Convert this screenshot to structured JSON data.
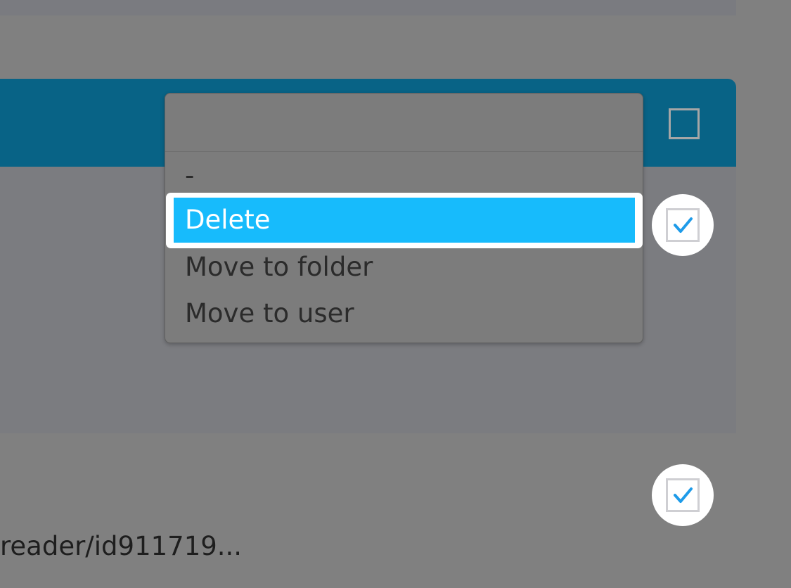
{
  "dropdown": {
    "options": [
      "-",
      "Delete",
      "Move to folder",
      "Move to user"
    ],
    "selected": "Delete"
  },
  "rows": [
    {
      "checked": true
    },
    {
      "checked": true,
      "path_text": "reader/id911719..."
    }
  ],
  "header": {
    "select_all_checked": false
  },
  "colors": {
    "header_bg": "#086386",
    "selected_option_bg": "#17bbfc",
    "check_color": "#1e9be9"
  },
  "icons": {
    "checkbox_checked": "check-icon"
  }
}
